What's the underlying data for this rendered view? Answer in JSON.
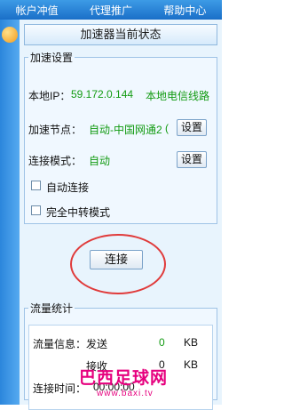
{
  "topbar": {
    "tabs": [
      "帐户冲值",
      "代理推广",
      "帮助中心"
    ]
  },
  "panel_title": "加速器当前状态",
  "settings": {
    "legend": "加速设置",
    "local_ip_label": "本地IP：",
    "local_ip_value": "59.172.0.144",
    "line_type": "本地电信线路",
    "node_label": "加速节点：",
    "node_value": "自动-中国网通2",
    "node_suffix": "(",
    "settings_button": "设置",
    "mode_label": "连接模式：",
    "mode_value": "自动",
    "auto_connect": "自动连接",
    "full_relay": "完全中转模式"
  },
  "connect_button": "连接",
  "stats": {
    "legend": "流量统计",
    "info_label": "流量信息：发送",
    "sent_value": "0",
    "sent_unit": "KB",
    "recv_label": "接收",
    "recv_value": "0",
    "recv_unit": "KB",
    "time_label": "连接时间：",
    "time_value": "00:00:00"
  },
  "watermark": {
    "title": "巴西足球网",
    "url": "www.baxi.tv"
  },
  "colors": {
    "accent_blue": "#1a6fc8",
    "panel_bg": "#e8f4fd",
    "status_green": "#139b13",
    "highlight_red": "#e03a3a",
    "watermark_magenta": "#e6007e"
  }
}
